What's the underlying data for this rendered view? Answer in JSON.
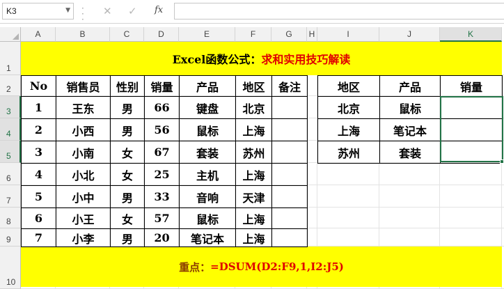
{
  "formula_bar": {
    "name_box": "K3",
    "cancel_glyph": "✕",
    "enter_glyph": "✓",
    "fx_label": "fx",
    "formula": ""
  },
  "columns": [
    "A",
    "B",
    "C",
    "D",
    "E",
    "F",
    "G",
    "H",
    "I",
    "J",
    "K"
  ],
  "rows": [
    "1",
    "2",
    "3",
    "4",
    "5",
    "6",
    "7",
    "8",
    "9",
    "10"
  ],
  "selected_cell": "K3",
  "title": {
    "part1": "Excel函数公式：",
    "part2": "求和实用技巧解读"
  },
  "main_table": {
    "headers": [
      "No",
      "销售员",
      "性别",
      "销量",
      "产品",
      "地区",
      "备注"
    ],
    "rows": [
      [
        "1",
        "王东",
        "男",
        "66",
        "键盘",
        "北京",
        ""
      ],
      [
        "2",
        "小西",
        "男",
        "56",
        "鼠标",
        "上海",
        ""
      ],
      [
        "3",
        "小南",
        "女",
        "67",
        "套装",
        "苏州",
        ""
      ],
      [
        "4",
        "小北",
        "女",
        "25",
        "主机",
        "上海",
        ""
      ],
      [
        "5",
        "小中",
        "男",
        "33",
        "音响",
        "天津",
        ""
      ],
      [
        "6",
        "小王",
        "女",
        "57",
        "鼠标",
        "上海",
        ""
      ],
      [
        "7",
        "小李",
        "男",
        "20",
        "笔记本",
        "上海",
        ""
      ]
    ]
  },
  "criteria_table": {
    "headers": [
      "地区",
      "产品",
      "销量"
    ],
    "rows": [
      [
        "北京",
        "鼠标",
        ""
      ],
      [
        "上海",
        "笔记本",
        ""
      ],
      [
        "苏州",
        "套装",
        ""
      ]
    ]
  },
  "footer": {
    "label": "重点：",
    "formula": "=DSUM(D2:F9,1,I2:J5)"
  },
  "colors": {
    "highlight": "#ffff00",
    "accent_red": "#e00000",
    "selection": "#217346"
  }
}
